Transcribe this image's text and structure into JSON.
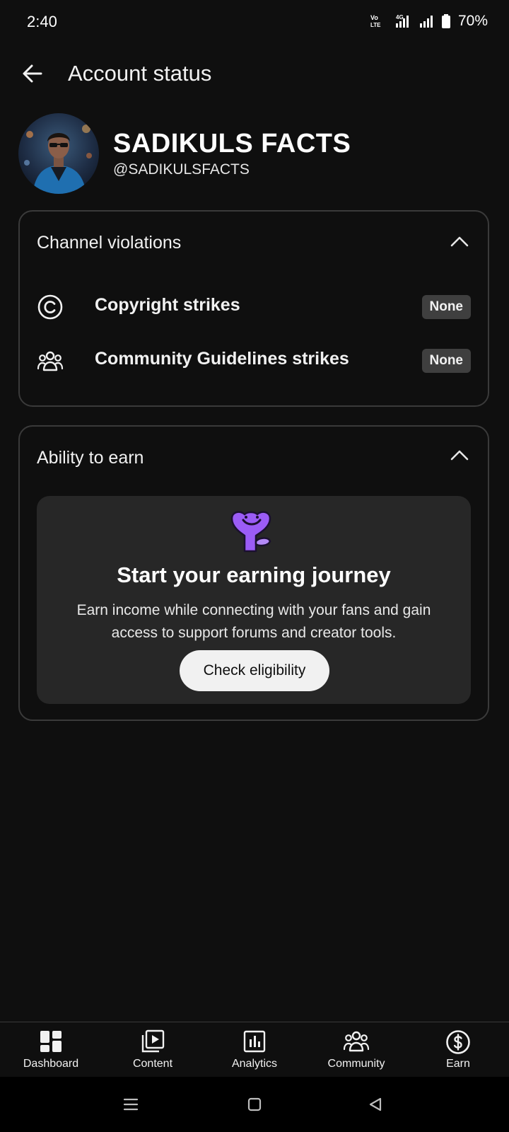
{
  "status_bar": {
    "time": "2:40",
    "volte_label": "Vo LTE",
    "network_label": "4G",
    "battery_percent": "70%"
  },
  "header": {
    "title": "Account status",
    "back_icon": "arrow-left-icon"
  },
  "profile": {
    "channel_name": "SADIKULS FACTS",
    "handle": "@SADIKULSFACTS"
  },
  "violations_card": {
    "title": "Channel violations",
    "rows": [
      {
        "label": "Copyright strikes",
        "badge": "None",
        "icon": "copyright-icon"
      },
      {
        "label": "Community Guidelines strikes",
        "badge": "None",
        "icon": "people-group-icon"
      }
    ]
  },
  "earn_card": {
    "title": "Ability to earn",
    "heading": "Start your earning journey",
    "description": "Earn income while connecting with your fans and gain access to support forums and creator tools.",
    "button_label": "Check eligibility",
    "mascot_color": "#9b5cf6"
  },
  "bottom_nav": {
    "items": [
      {
        "label": "Dashboard",
        "icon": "dashboard-grid-icon"
      },
      {
        "label": "Content",
        "icon": "content-play-icon"
      },
      {
        "label": "Analytics",
        "icon": "analytics-chart-icon"
      },
      {
        "label": "Community",
        "icon": "community-people-icon"
      },
      {
        "label": "Earn",
        "icon": "dollar-circle-icon"
      }
    ]
  },
  "colors": {
    "background": "#0f0f0f",
    "card_border": "#3a3a3a",
    "panel": "#272727",
    "badge": "#3f3f3f",
    "button": "#f1f1f1"
  }
}
